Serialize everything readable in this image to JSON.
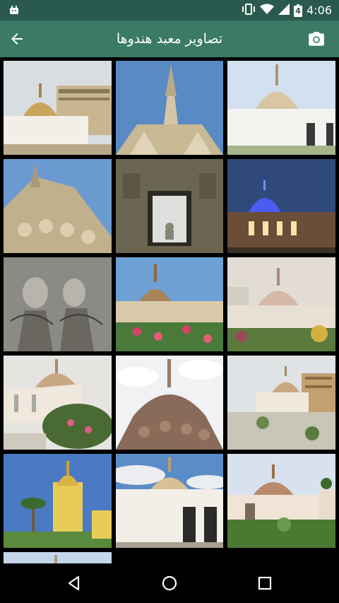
{
  "status_bar": {
    "time": "4:06",
    "battery_level": "4",
    "icons": [
      "android-icon",
      "vibrate-icon",
      "wifi-icon",
      "signal-icon",
      "battery-icon"
    ]
  },
  "app_bar": {
    "title": "تصاویر معبد هندوها",
    "back_icon": "arrow-back-icon",
    "camera_icon": "camera-icon"
  },
  "colors": {
    "status_bar": "#2a5a4d",
    "app_bar": "#3a7a66",
    "background": "#000000"
  },
  "gallery": {
    "columns": 3,
    "tiles": [
      {
        "id": 1,
        "subject": "temple-dome-beside-building"
      },
      {
        "id": 2,
        "subject": "temple-spire-closeup"
      },
      {
        "id": 3,
        "subject": "temple-dome-white-wall"
      },
      {
        "id": 4,
        "subject": "spire-detail-angle"
      },
      {
        "id": 5,
        "subject": "interior-window-statue"
      },
      {
        "id": 6,
        "subject": "temple-night-blue-light"
      },
      {
        "id": 7,
        "subject": "wall-painting"
      },
      {
        "id": 8,
        "subject": "temple-with-flowers"
      },
      {
        "id": 9,
        "subject": "temple-with-plants"
      },
      {
        "id": 10,
        "subject": "temple-side-view"
      },
      {
        "id": 11,
        "subject": "spire-sunny-clouds"
      },
      {
        "id": 12,
        "subject": "temple-yard"
      },
      {
        "id": 13,
        "subject": "yellow-temple-palms"
      },
      {
        "id": 14,
        "subject": "temple-white-facade"
      },
      {
        "id": 15,
        "subject": "temple-dome-garden"
      },
      {
        "id": 16,
        "subject": "partial-tile"
      }
    ]
  },
  "nav_bar": {
    "back": "nav-back-icon",
    "home": "nav-home-icon",
    "recents": "nav-recents-icon"
  }
}
